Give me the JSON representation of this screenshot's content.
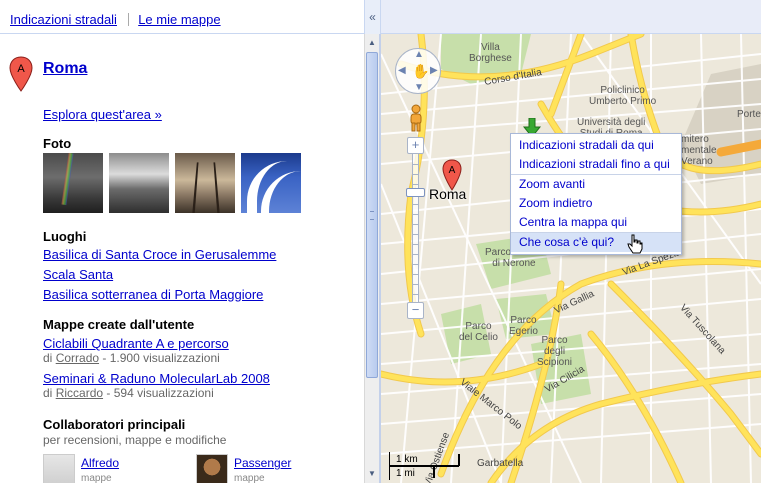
{
  "top_links": {
    "directions": "Indicazioni stradali",
    "my_maps": "Le mie mappe"
  },
  "collapse_icon": "«",
  "place": {
    "marker_letter": "A",
    "title": "Roma",
    "explore_link": "Esplora quest'area »"
  },
  "photos": {
    "title": "Foto"
  },
  "places": {
    "title": "Luoghi",
    "items": [
      "Basilica di Santa Croce in Gerusalemme",
      "Scala Santa",
      "Basilica sotterranea di Porta Maggiore"
    ]
  },
  "user_maps": {
    "title": "Mappe create dall'utente",
    "items": [
      {
        "name": "Ciclabili Quadrante A e percorso",
        "by": "di",
        "author": "Corrado",
        "views": "- 1.900 visualizzazioni"
      },
      {
        "name": "Seminari & Raduno MolecularLab 2008",
        "by": "di",
        "author": "Riccardo",
        "views": "- 594 visualizzazioni"
      }
    ]
  },
  "collaborators": {
    "title": "Collaboratori principali",
    "subtitle": "per recensioni, mappe e modifiche",
    "people": [
      {
        "name": "Alfredo",
        "sub": "mappe"
      },
      {
        "name": "Passenger",
        "sub": "mappe"
      }
    ]
  },
  "map": {
    "marker_letter": "A",
    "marker_label": "Roma",
    "labels": {
      "villa_borghese": "Villa\nBorghese",
      "corso_italia": "Corso d'Italia",
      "policlinico": "Policlinico\nUmberto Primo",
      "universita": "Università degli\nStudi di Roma",
      "cimitero": "mitero\nmentale\nVerano",
      "porta": "Porte",
      "parco_ninfeo": "Parco Ninfeo\ndi Nerone",
      "parco_celio": "Parco\ndel Celio",
      "parco_egerio": "Parco\nEgerio",
      "parco_scipioni": "Parco\ndegli\nScipioni",
      "via_la_spezia": "Via La Spezia",
      "via_tuscolana": "Via Tuscolana",
      "via_gallia": "Via Gallia",
      "viale_marco_polo": "Viale Marco Polo",
      "via_cilicia": "Via Cilicia",
      "via_ostiense": "Via Ostiense",
      "garbatella": "Garbatella"
    },
    "scale": {
      "km": "1 km",
      "mi": "1 mi"
    },
    "colors": {
      "road": "#ffe35b",
      "land": "#ede8db",
      "park": "#c7dfaa",
      "street": "#ffffff"
    }
  },
  "context_menu": {
    "items": [
      "Indicazioni stradali da qui",
      "Indicazioni stradali fino a qui",
      "Zoom avanti",
      "Zoom indietro",
      "Centra la mappa qui",
      "Che cosa c'è qui?"
    ],
    "hovered_index": 5
  },
  "icons": {
    "marker": "map-marker-icon",
    "pan": "pan-control-icon",
    "pegman": "pegman-icon",
    "cursor": "hand-cursor-icon"
  }
}
